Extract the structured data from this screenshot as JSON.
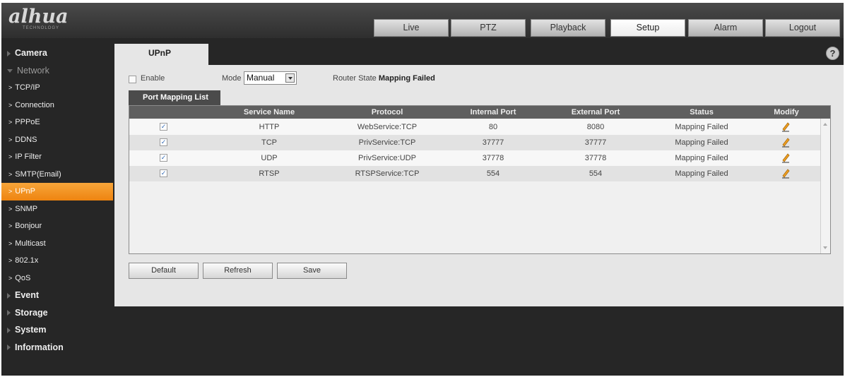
{
  "logo": {
    "brand": "alhua",
    "sub": "TECHNOLOGY"
  },
  "nav": {
    "tabs": [
      {
        "label": "Live"
      },
      {
        "label": "PTZ"
      },
      {
        "label": "Playback"
      },
      {
        "label": "Setup",
        "active": true
      },
      {
        "label": "Alarm"
      },
      {
        "label": "Logout"
      }
    ]
  },
  "sidebar": {
    "items": [
      {
        "label": "Camera",
        "kind": "section"
      },
      {
        "label": "Network",
        "kind": "section-open"
      },
      {
        "label": "TCP/IP",
        "kind": "sub"
      },
      {
        "label": "Connection",
        "kind": "sub"
      },
      {
        "label": "PPPoE",
        "kind": "sub"
      },
      {
        "label": "DDNS",
        "kind": "sub"
      },
      {
        "label": "IP Filter",
        "kind": "sub"
      },
      {
        "label": "SMTP(Email)",
        "kind": "sub"
      },
      {
        "label": "UPnP",
        "kind": "sub",
        "active": true
      },
      {
        "label": "SNMP",
        "kind": "sub"
      },
      {
        "label": "Bonjour",
        "kind": "sub"
      },
      {
        "label": "Multicast",
        "kind": "sub"
      },
      {
        "label": "802.1x",
        "kind": "sub"
      },
      {
        "label": "QoS",
        "kind": "sub"
      },
      {
        "label": "Event",
        "kind": "section"
      },
      {
        "label": "Storage",
        "kind": "section"
      },
      {
        "label": "System",
        "kind": "section"
      },
      {
        "label": "Information",
        "kind": "section"
      }
    ]
  },
  "page": {
    "tab_title": "UPnP",
    "help_icon": "?",
    "enable_label": "Enable",
    "enable_checked": false,
    "mode_label": "Mode",
    "mode_value": "Manual",
    "router_state_label": "Router State",
    "router_state_value": "Mapping Failed",
    "mapping_tab": "Port Mapping List"
  },
  "table": {
    "columns": [
      "Service Name",
      "Protocol",
      "Internal Port",
      "External Port",
      "Status",
      "Modify"
    ],
    "rows": [
      {
        "checked": true,
        "service": "HTTP",
        "protocol": "WebService:TCP",
        "internal": "80",
        "external": "8080",
        "status": "Mapping Failed"
      },
      {
        "checked": true,
        "service": "TCP",
        "protocol": "PrivService:TCP",
        "internal": "37777",
        "external": "37777",
        "status": "Mapping Failed"
      },
      {
        "checked": true,
        "service": "UDP",
        "protocol": "PrivService:UDP",
        "internal": "37778",
        "external": "37778",
        "status": "Mapping Failed"
      },
      {
        "checked": true,
        "service": "RTSP",
        "protocol": "RTSPService:TCP",
        "internal": "554",
        "external": "554",
        "status": "Mapping Failed"
      }
    ]
  },
  "buttons": {
    "default": "Default",
    "refresh": "Refresh",
    "save": "Save"
  },
  "colors": {
    "accent": "#f29122",
    "header": "#3a3a3a",
    "sidebar": "#262626",
    "panel": "#e6e6e6"
  }
}
